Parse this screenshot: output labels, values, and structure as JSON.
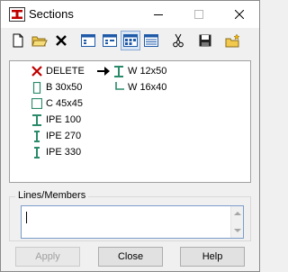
{
  "window": {
    "title": "Sections",
    "app_icon": "steel-section-icon"
  },
  "toolbar": {
    "buttons": [
      {
        "name": "new-icon"
      },
      {
        "name": "open-folder-icon"
      },
      {
        "name": "delete-x-icon"
      },
      {
        "name": "view-list-icon"
      },
      {
        "name": "view-details-icon"
      },
      {
        "name": "view-grid-icon"
      },
      {
        "name": "view-table-icon"
      },
      {
        "name": "cut-icon"
      },
      {
        "name": "save-icon"
      },
      {
        "name": "open-folder-star-icon"
      }
    ]
  },
  "list": {
    "left": [
      {
        "label": "DELETE",
        "icon": "delete-x-icon",
        "color": "#c00000"
      },
      {
        "label": "B 30x50",
        "icon": "rectangle-section-icon",
        "color": "#2a8a6a"
      },
      {
        "label": "C 45x45",
        "icon": "square-section-icon",
        "color": "#2a8a6a"
      },
      {
        "label": "IPE 100",
        "icon": "i-beam-icon",
        "color": "#2a8a6a"
      },
      {
        "label": "IPE 270",
        "icon": "i-beam-icon",
        "color": "#2a8a6a"
      },
      {
        "label": "IPE 330",
        "icon": "i-beam-icon",
        "color": "#2a8a6a"
      }
    ],
    "right": [
      {
        "label": "W 12x50",
        "icon": "i-beam-icon",
        "color": "#2a8a6a"
      },
      {
        "label": "W 16x40",
        "icon": "tree-branch-icon",
        "color": "#2a8a6a"
      }
    ]
  },
  "lines_members": {
    "label": "Lines/Members",
    "value": ""
  },
  "buttons": {
    "apply": "Apply",
    "close": "Close",
    "help": "Help"
  }
}
